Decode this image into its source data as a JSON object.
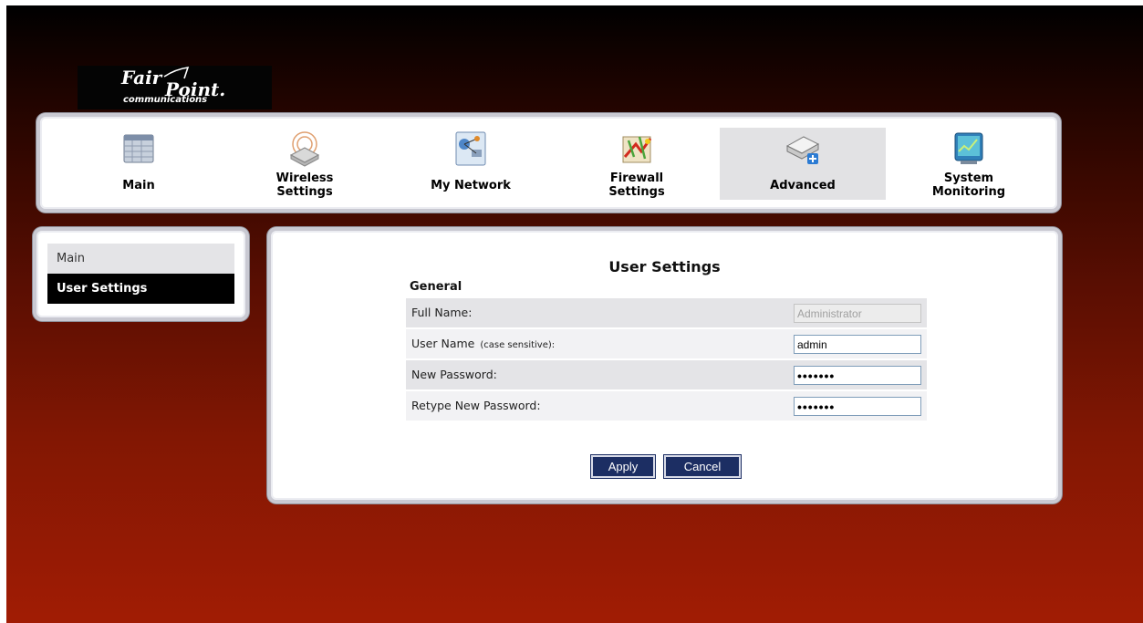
{
  "logo": {
    "line1": "Fair",
    "line2": "Point.",
    "line3": "communications"
  },
  "nav": {
    "items": [
      {
        "label": "Main",
        "icon": "table-icon"
      },
      {
        "label": "Wireless\nSettings",
        "icon": "wireless-router-icon"
      },
      {
        "label": "My Network",
        "icon": "network-map-icon"
      },
      {
        "label": "Firewall\nSettings",
        "icon": "firewall-icon"
      },
      {
        "label": "Advanced",
        "icon": "advanced-scanner-icon"
      },
      {
        "label": "System\nMonitoring",
        "icon": "monitor-icon"
      }
    ],
    "active": "Advanced"
  },
  "sidebar": {
    "items": [
      {
        "label": "Main"
      },
      {
        "label": "User Settings"
      }
    ],
    "active": "User Settings"
  },
  "main": {
    "title": "User Settings",
    "section": "General",
    "fields": [
      {
        "label": "Full Name:",
        "value": "Administrator",
        "disabled": true
      },
      {
        "label": "User Name",
        "note": "(case sensitive):",
        "value": "admin"
      },
      {
        "label": "New Password:",
        "value": "•••••••"
      },
      {
        "label": "Retype New Password:",
        "value": "•••••••"
      }
    ],
    "apply_label": "Apply",
    "cancel_label": "Cancel"
  },
  "colors": {
    "button_bg": "#1c2e63",
    "sidebar_active_bg": "#000000",
    "nav_active_bg": "#e2e2e4",
    "background_top": "#000000",
    "background_bottom": "#a11c04"
  }
}
